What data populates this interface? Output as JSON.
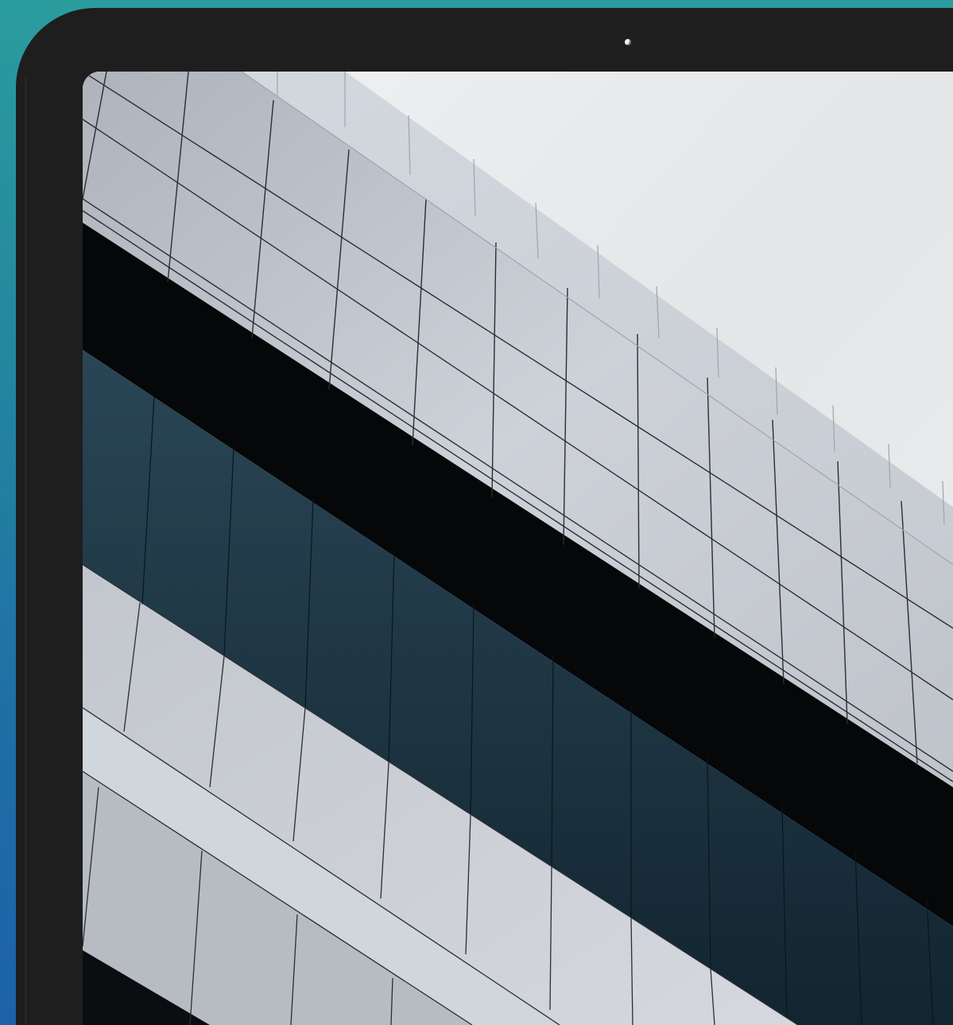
{
  "colors": {
    "background_gradient_top": "#2a9c9e",
    "background_gradient_bottom": "#1c62a8",
    "device_bezel": "#1e1e1e",
    "camera": "#f2f2f2",
    "sky": "#e9eaeb",
    "facade_panel": "#c9ccd2",
    "shadow_band": "#050709",
    "window_glass": "#1f3a48"
  },
  "icons": {
    "camera": "front-camera-dot"
  },
  "screen": {
    "content": "wallpaper-photo",
    "subject": "glass-building-facade"
  }
}
